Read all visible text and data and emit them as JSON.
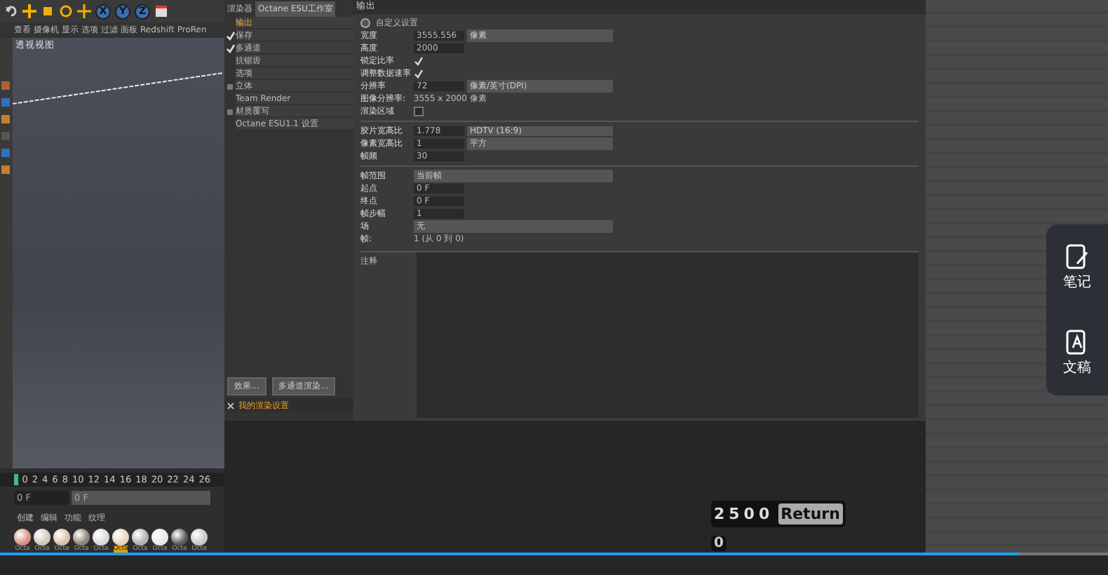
{
  "toolbar": {
    "axes": [
      "X",
      "Y",
      "Z"
    ]
  },
  "viewport": {
    "menu": [
      "查看",
      "摄像机",
      "显示",
      "选项",
      "过滤",
      "面板",
      "Redshift",
      "ProRen"
    ],
    "title": "透视视图"
  },
  "timeline": {
    "ticks": [
      "0",
      "2",
      "4",
      "6",
      "8",
      "10",
      "12",
      "14",
      "16",
      "18",
      "20",
      "22",
      "24",
      "26"
    ],
    "start": "0 F",
    "current": "0 F"
  },
  "materials": {
    "menu": [
      "创建",
      "编辑",
      "功能",
      "纹理"
    ],
    "items": [
      {
        "label": "Octa",
        "color": "#d98f84",
        "selected": false
      },
      {
        "label": "Octa",
        "color": "#cfc6b8",
        "selected": false
      },
      {
        "label": "Octa",
        "color": "#d8c2a8",
        "selected": false
      },
      {
        "label": "Octa",
        "color": "#8a8478",
        "selected": false
      },
      {
        "label": "Octa",
        "color": "#d6d8da",
        "selected": false
      },
      {
        "label": "Octa",
        "color": "#e2d5bd",
        "selected": true
      },
      {
        "label": "Octa",
        "color": "#b0b0b0",
        "selected": false
      },
      {
        "label": "Octa",
        "color": "#e8e8e8",
        "selected": false
      },
      {
        "label": "Octa",
        "color": "#5a5a5a",
        "selected": false
      },
      {
        "label": "Octa",
        "color": "#c8c8c8",
        "selected": false
      }
    ]
  },
  "render_settings": {
    "renderer_label": "渲染器",
    "renderer": "Octane ESU工作室",
    "sidebar": [
      {
        "label": "输出",
        "kind": "plain",
        "selected": true
      },
      {
        "label": "保存",
        "kind": "toggle",
        "checked": true,
        "selected": false
      },
      {
        "label": "多通道",
        "kind": "toggle",
        "checked": true,
        "selected": false
      },
      {
        "label": "抗锯齿",
        "kind": "plain",
        "selected": false
      },
      {
        "label": "选项",
        "kind": "plain",
        "selected": false
      },
      {
        "label": "立体",
        "kind": "toggle",
        "checked": false,
        "selected": false
      },
      {
        "label": "Team Render",
        "kind": "plain",
        "selected": false
      },
      {
        "label": "材质覆写",
        "kind": "toggle",
        "checked": false,
        "selected": false
      },
      {
        "label": "Octane ESU1.1 设置",
        "kind": "plain",
        "selected": false
      }
    ],
    "buttons": [
      "效果...",
      "多通道渲染..."
    ],
    "preset": "我的渲染设置",
    "section": "输出",
    "preset_title": "自定义设置",
    "groups": [
      [
        {
          "kind": "number",
          "label": "宽度",
          "value": "3555.556",
          "unit": "像素"
        },
        {
          "kind": "number",
          "label": "高度",
          "value": "2000"
        },
        {
          "kind": "check",
          "label": "锁定比率",
          "checked": true
        },
        {
          "kind": "check",
          "label": "调整数据速率",
          "checked": true
        },
        {
          "kind": "number",
          "label": "分辨率",
          "value": "72",
          "unit": "像素/英寸(DPI)"
        },
        {
          "kind": "info",
          "label": "图像分辨率:",
          "value": "3555 x 2000 像素"
        },
        {
          "kind": "check",
          "label": "渲染区域",
          "checked": false
        }
      ],
      [
        {
          "kind": "number",
          "label": "胶片宽高比",
          "value": "1.778",
          "unit": "HDTV (16:9)"
        },
        {
          "kind": "number",
          "label": "像素宽高比",
          "value": "1",
          "unit": "平方"
        },
        {
          "kind": "number",
          "label": "帧频",
          "value": "30"
        }
      ],
      [
        {
          "kind": "select",
          "label": "帧范围",
          "value": "当前帧"
        },
        {
          "kind": "number",
          "label": "起点",
          "value": "0 F"
        },
        {
          "kind": "number",
          "label": "终点",
          "value": "0 F"
        },
        {
          "kind": "number",
          "label": "帧步幅",
          "value": "1"
        },
        {
          "kind": "select",
          "label": "场",
          "value": "无"
        },
        {
          "kind": "info",
          "label": "帧:",
          "value": "1 (从 0 到 0)"
        }
      ]
    ],
    "notes_label": "注释"
  },
  "side_panel": [
    {
      "label": "笔记",
      "kind": "note"
    },
    {
      "label": "文稿",
      "kind": "doc"
    }
  ],
  "keystrokes": {
    "keys": [
      "2500",
      "Return"
    ],
    "last": "0"
  },
  "video": {
    "level": 0.92
  }
}
